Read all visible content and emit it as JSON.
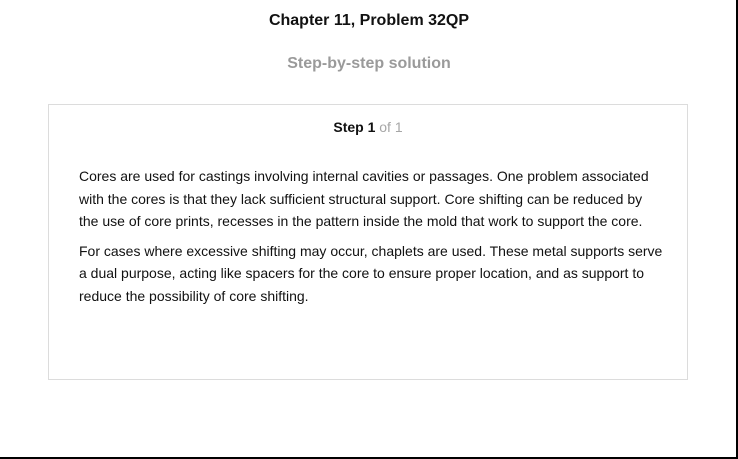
{
  "page": {
    "title": "Chapter 11, Problem 32QP",
    "subtitle": "Step-by-step solution"
  },
  "step": {
    "label": "Step 1",
    "of_text": "of 1",
    "paragraphs": [
      "Cores are used for castings involving internal cavities or passages. One problem associated with the cores is that they lack sufficient structural support. Core shifting can be reduced by the use of core prints, recesses in the pattern inside the mold that work to support the core.",
      "For cases where excessive shifting may occur, chaplets are used. These metal supports serve a dual purpose, acting like spacers for the core to ensure proper location, and as support to reduce the possibility of core shifting."
    ]
  }
}
